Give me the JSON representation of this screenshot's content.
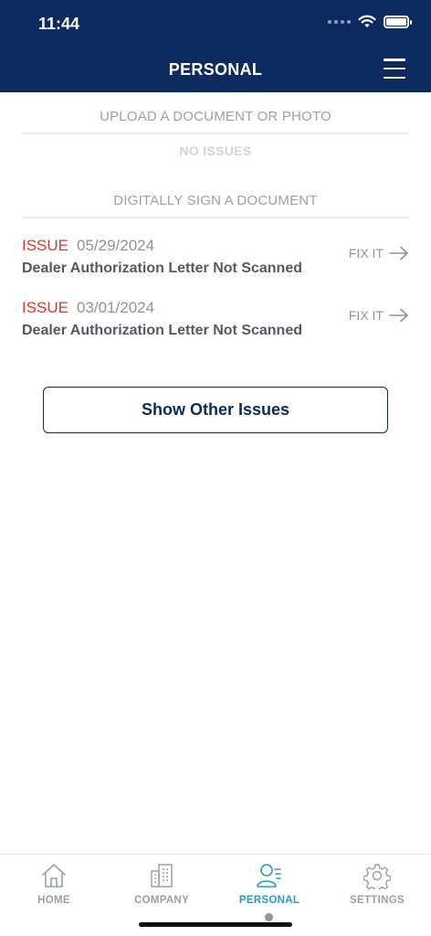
{
  "status_bar": {
    "time": "11:44"
  },
  "header": {
    "title": "PERSONAL"
  },
  "sections": {
    "upload": {
      "heading": "UPLOAD A DOCUMENT OR PHOTO",
      "empty_text": "NO ISSUES"
    },
    "sign": {
      "heading": "DIGITALLY SIGN A DOCUMENT"
    }
  },
  "issues": [
    {
      "tag": "ISSUE",
      "date": "05/29/2024",
      "description": "Dealer Authorization Letter Not Scanned",
      "action": "FIX IT"
    },
    {
      "tag": "ISSUE",
      "date": "03/01/2024",
      "description": "Dealer Authorization Letter Not Scanned",
      "action": "FIX IT"
    }
  ],
  "show_other_button": "Show Other Issues",
  "tabs": [
    {
      "label": "HOME",
      "icon": "home-icon",
      "active": false
    },
    {
      "label": "COMPANY",
      "icon": "building-icon",
      "active": false
    },
    {
      "label": "PERSONAL",
      "icon": "person-icon",
      "active": true
    },
    {
      "label": "SETTINGS",
      "icon": "gear-icon",
      "active": false
    }
  ],
  "colors": {
    "header_bg": "#0c2a5e",
    "issue_red": "#e53123",
    "active_tab": "#2b97d1",
    "muted_text": "#8e939b"
  }
}
